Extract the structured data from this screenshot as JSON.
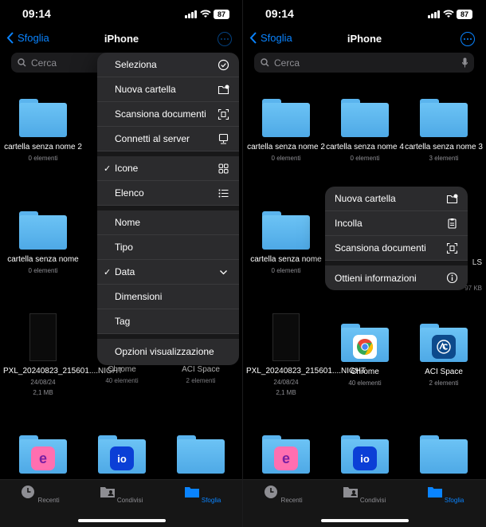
{
  "status": {
    "time": "09:14",
    "battery": "87"
  },
  "nav": {
    "back": "Sfoglia",
    "title": "iPhone"
  },
  "search": {
    "placeholder": "Cerca"
  },
  "left_items": [
    {
      "name": "cartella senza nome 2",
      "meta": "0 elementi"
    },
    {
      "name": "cartella senza nome",
      "meta": "0 elementi"
    },
    {
      "name": "PXL_20240823_215601....NIGHT",
      "date": "24/08/24",
      "size": "2,1 MB"
    },
    {
      "name": "Chrome",
      "meta": "40 elementi"
    },
    {
      "name": "ACI Space",
      "meta": "2 elementi"
    }
  ],
  "right_items": [
    {
      "name": "cartella senza nome 2",
      "meta": "0 elementi"
    },
    {
      "name": "cartella senza nome 4",
      "meta": "0 elementi"
    },
    {
      "name": "cartella senza nome 3",
      "meta": "3 elementi"
    },
    {
      "name": "cartella senza nome",
      "meta": "0 elementi"
    },
    {
      "partial_name": "LS",
      "partial_meta": "97 KB"
    },
    {
      "name": "PXL_20240823_215601....NIGHT",
      "date": "24/08/24",
      "size": "2,1 MB"
    },
    {
      "name": "Chrome",
      "meta": "40 elementi"
    },
    {
      "name": "ACI Space",
      "meta": "2 elementi"
    }
  ],
  "menu": {
    "seleziona": "Seleziona",
    "nuova_cartella": "Nuova cartella",
    "scansiona": "Scansiona documenti",
    "connetti": "Connetti al server",
    "icone": "Icone",
    "elenco": "Elenco",
    "nome": "Nome",
    "tipo": "Tipo",
    "data": "Data",
    "dimensioni": "Dimensioni",
    "tag": "Tag",
    "opzioni": "Opzioni visualizzazione",
    "checkmark": "✓"
  },
  "context_menu": {
    "nuova_cartella": "Nuova cartella",
    "incolla": "Incolla",
    "scansiona": "Scansiona documenti",
    "info": "Ottieni informazioni"
  },
  "tabbar": {
    "recenti": "Recenti",
    "condivisi": "Condivisi",
    "sfoglia": "Sfoglia"
  },
  "colors": {
    "accent": "#0a84ff",
    "folder": "#5ab4ee",
    "background": "#000000",
    "menu": "#2c2c2e"
  },
  "badges": {
    "e_app": "e",
    "io_app": "io"
  }
}
